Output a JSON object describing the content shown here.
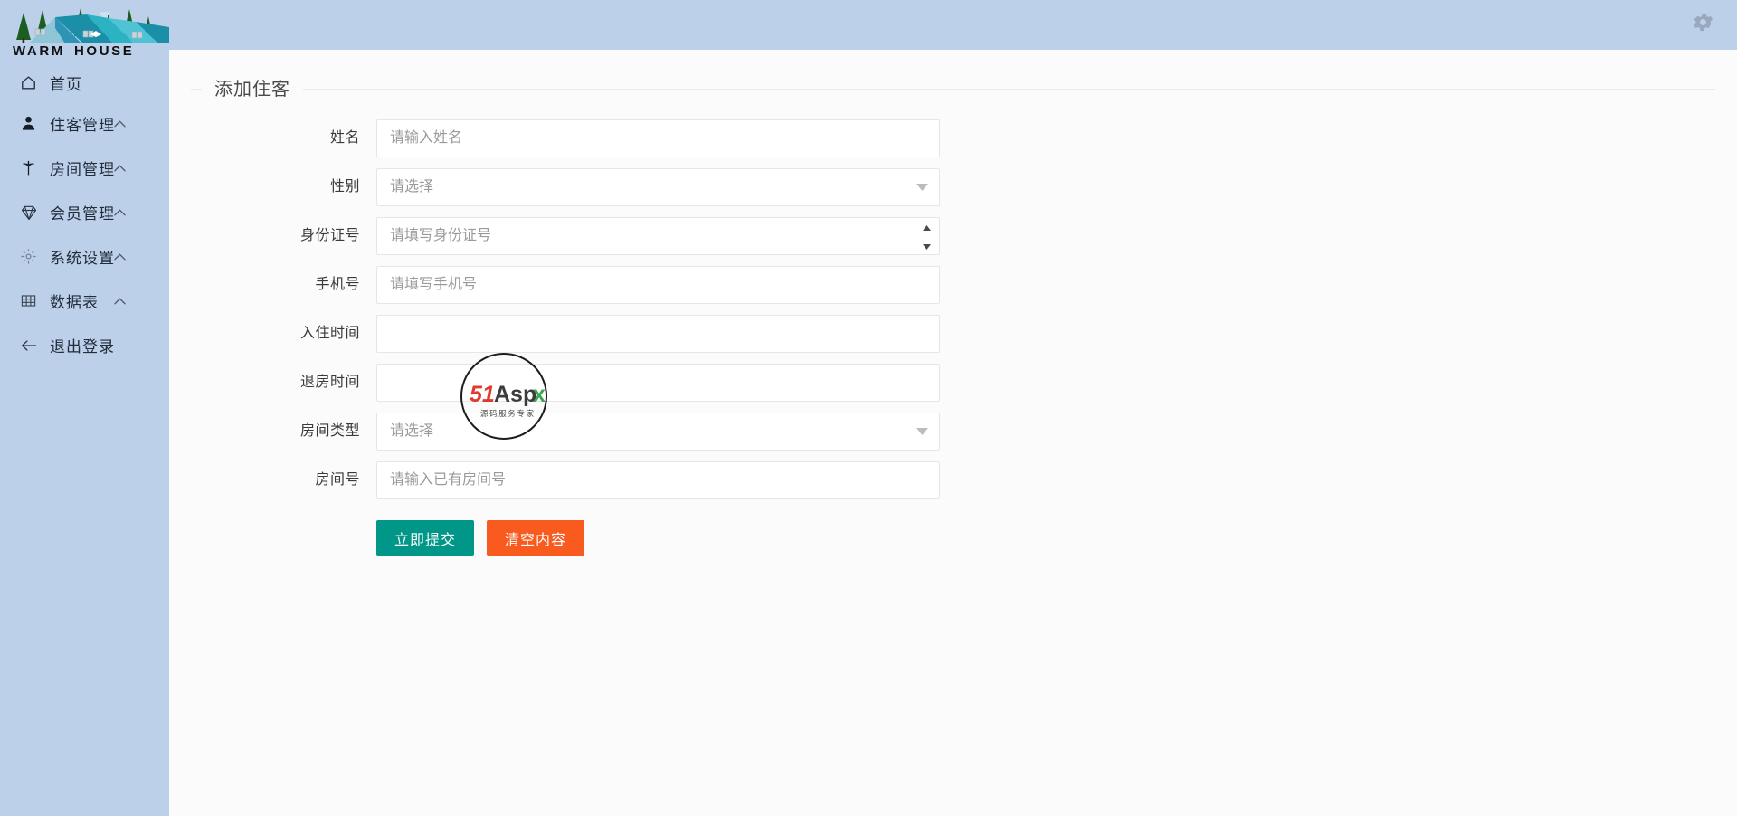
{
  "brand": {
    "name": "WARM HOUSE",
    "logo_icon": "house-roofs-pines-logo"
  },
  "sidebar": {
    "items": [
      {
        "label": "首页",
        "icon": "home-icon",
        "caret": "",
        "has_caret": false
      },
      {
        "label": "住客管理",
        "icon": "user-icon",
        "caret": "⌃",
        "has_caret": true
      },
      {
        "label": "房间管理",
        "icon": "tree-icon",
        "caret": "⌃",
        "has_caret": true
      },
      {
        "label": "会员管理",
        "icon": "diamond-icon",
        "caret": "⌃",
        "has_caret": true
      },
      {
        "label": "系统设置",
        "icon": "gear-icon",
        "caret": "⌃",
        "has_caret": true
      },
      {
        "label": "数据表",
        "icon": "table-icon",
        "caret": "⌃",
        "has_caret": true
      },
      {
        "label": "退出登录",
        "icon": "arrow-left-icon",
        "caret": "",
        "has_caret": false
      }
    ]
  },
  "topbar": {
    "settings_icon": "gear-icon"
  },
  "main": {
    "panel_title": "添加住客",
    "fields": {
      "name": {
        "label": "姓名",
        "placeholder": "请输入姓名",
        "value": "",
        "type": "text"
      },
      "gender": {
        "label": "性别",
        "placeholder": "请选择",
        "value": "",
        "type": "select"
      },
      "id_number": {
        "label": "身份证号",
        "placeholder": "请填写身份证号",
        "value": "",
        "type": "number"
      },
      "phone": {
        "label": "手机号",
        "placeholder": "请填写手机号",
        "value": "",
        "type": "text"
      },
      "checkin": {
        "label": "入住时间",
        "placeholder": "",
        "value": "",
        "type": "date"
      },
      "checkout": {
        "label": "退房时间",
        "placeholder": "",
        "value": "",
        "type": "date"
      },
      "room_type": {
        "label": "房间类型",
        "placeholder": "请选择",
        "value": "",
        "type": "select"
      },
      "room_number": {
        "label": "房间号",
        "placeholder": "请输入已有房间号",
        "value": "",
        "type": "text"
      }
    },
    "buttons": {
      "submit": "立即提交",
      "clear": "清空内容"
    }
  },
  "watermark": {
    "text_main": "51Aspx",
    "text_sub": "源码服务专家"
  },
  "colors": {
    "sidebar_bg": "#bdd0e9",
    "header_bg": "#bdd0e9",
    "content_bg": "#fbfbfb",
    "submit_green": "#009688",
    "clear_orange": "#f95b1f",
    "border": "#e6e6e6",
    "placeholder": "#9a9a9a"
  }
}
